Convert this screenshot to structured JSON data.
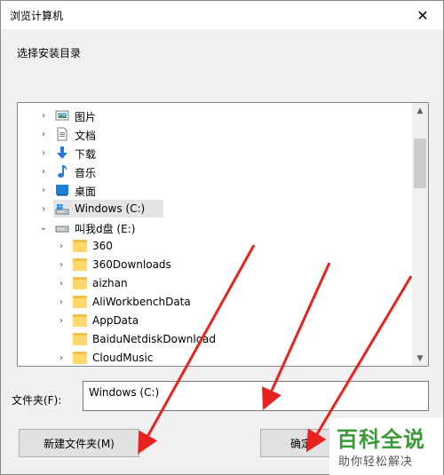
{
  "window": {
    "title": "浏览计算机",
    "close_glyph": "✕"
  },
  "prompt": "选择安装目录",
  "tree": {
    "items": [
      {
        "label": "图片",
        "icon": "pictures-icon"
      },
      {
        "label": "文档",
        "icon": "documents-icon"
      },
      {
        "label": "下载",
        "icon": "downloads-icon"
      },
      {
        "label": "音乐",
        "icon": "music-icon"
      },
      {
        "label": "桌面",
        "icon": "desktop-icon"
      },
      {
        "label": "Windows (C:)",
        "icon": "windows-drive-icon"
      },
      {
        "label": "叫我d盘 (E:)",
        "icon": "drive-icon"
      },
      {
        "label": "360",
        "icon": "folder-icon"
      },
      {
        "label": "360Downloads",
        "icon": "folder-icon"
      },
      {
        "label": "aizhan",
        "icon": "folder-icon"
      },
      {
        "label": "AliWorkbenchData",
        "icon": "folder-icon"
      },
      {
        "label": "AppData",
        "icon": "folder-icon"
      },
      {
        "label": "BaiduNetdiskDownload",
        "icon": "folder-icon"
      },
      {
        "label": "CloudMusic",
        "icon": "folder-icon"
      }
    ]
  },
  "folder_field": {
    "label": "文件夹(F):",
    "value": "Windows (C:)"
  },
  "buttons": {
    "new_folder": "新建文件夹(M)",
    "ok": "确定"
  },
  "watermark": {
    "main": "百科全说",
    "sub": "助你轻松解决"
  },
  "colors": {
    "annotation_arrow": "#e8231f",
    "watermark_green": "#3a9a3a"
  }
}
